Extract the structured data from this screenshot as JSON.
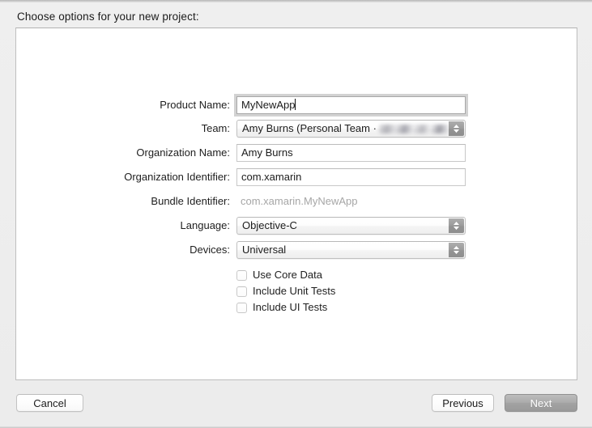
{
  "window": {
    "prompt": "Choose options for your new project:"
  },
  "form": {
    "fields": [
      {
        "name": "product-name",
        "label": "Product Name:",
        "type": "text",
        "value": "MyNewApp",
        "focused": true
      },
      {
        "name": "team",
        "label": "Team:",
        "type": "popup",
        "value": "Amy Burns (Personal Team ·",
        "redacted": true
      },
      {
        "name": "organization-name",
        "label": "Organization Name:",
        "type": "text",
        "value": "Amy Burns",
        "focused": false
      },
      {
        "name": "organization-identifier",
        "label": "Organization Identifier:",
        "type": "text",
        "value": "com.xamarin",
        "focused": false
      },
      {
        "name": "bundle-identifier",
        "label": "Bundle Identifier:",
        "type": "static",
        "value": "com.xamarin.MyNewApp"
      },
      {
        "name": "language",
        "label": "Language:",
        "type": "popup",
        "value": "Objective-C",
        "redacted": false
      },
      {
        "name": "devices",
        "label": "Devices:",
        "type": "popup",
        "value": "Universal",
        "redacted": false
      }
    ],
    "checkboxes": [
      {
        "name": "use-core-data",
        "label": "Use Core Data",
        "checked": false
      },
      {
        "name": "include-unit-tests",
        "label": "Include Unit Tests",
        "checked": false
      },
      {
        "name": "include-ui-tests",
        "label": "Include UI Tests",
        "checked": false
      }
    ]
  },
  "footer": {
    "cancel_label": "Cancel",
    "previous_label": "Previous",
    "next_label": "Next"
  },
  "colors": {
    "window_background": "#ececec",
    "panel_background": "#ffffff",
    "panel_border": "#bdbdbd",
    "text": "#1e1e1e",
    "disabled_text": "#a6a6a6",
    "default_button": "#a2a2a2"
  }
}
